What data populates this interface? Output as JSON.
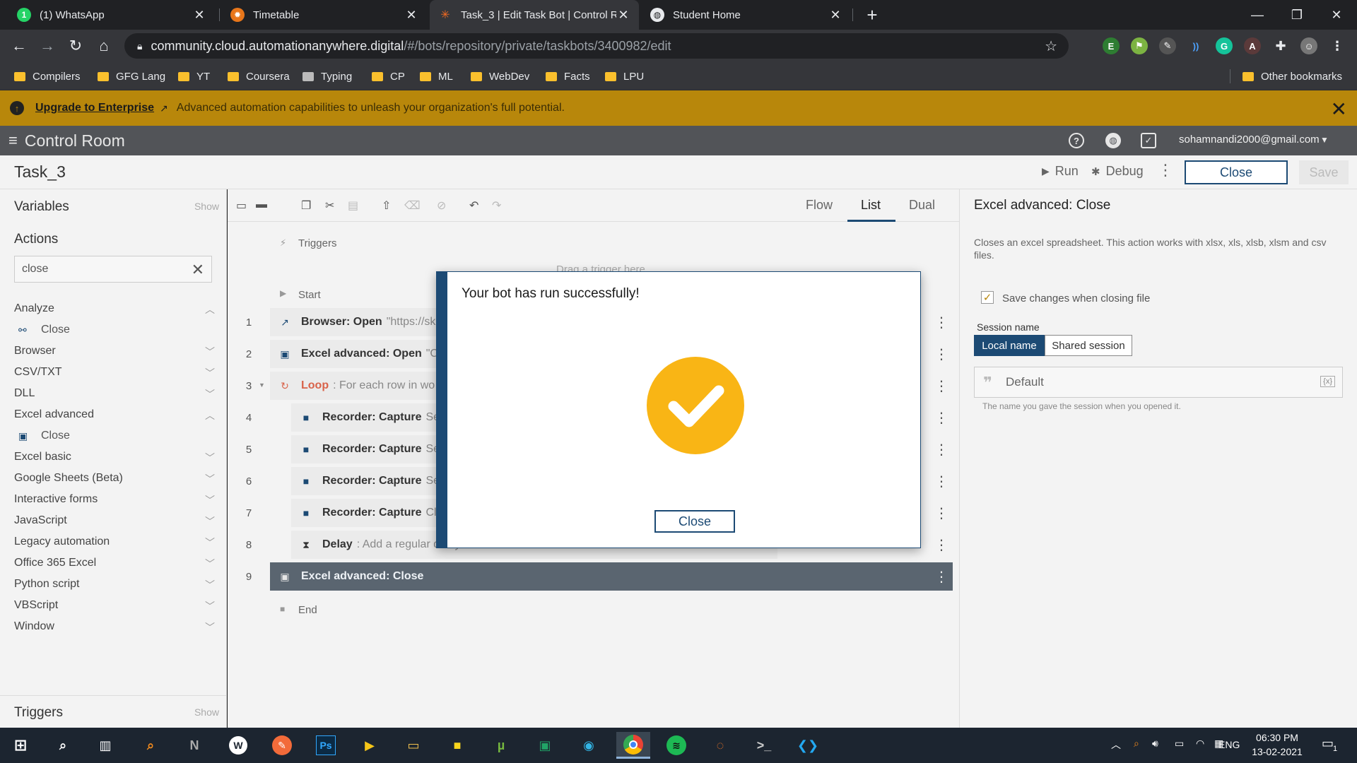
{
  "browser": {
    "tabs": [
      {
        "title": "(1) WhatsApp",
        "icon": "whatsapp-icon",
        "active": false
      },
      {
        "title": "Timetable",
        "icon": "timetable-icon",
        "active": false
      },
      {
        "title": "Task_3 | Edit Task Bot | Control Ro",
        "icon": "automation-anywhere-icon",
        "active": true
      },
      {
        "title": "Student Home",
        "icon": "globe-icon",
        "active": false
      }
    ],
    "new_tab": "+",
    "url_host": "community.cloud.automationanywhere.digital",
    "url_path": "/#/bots/repository/private/taskbots/3400982/edit",
    "bookmarks": [
      "Compilers",
      "GFG Lang",
      "YT",
      "Coursera",
      "Typing",
      "CP",
      "ML",
      "WebDev",
      "Facts",
      "LPU"
    ],
    "other_bookmarks": "Other bookmarks"
  },
  "app": {
    "upgrade": {
      "link": "Upgrade to Enterprise",
      "text": "Advanced automation capabilities to unleash your organization's full potential."
    },
    "brand": "Control Room",
    "user": "sohamnandi2000@gmail.com",
    "task_title": "Task_3",
    "run": "Run",
    "debug": "Debug",
    "close": "Close",
    "save": "Save"
  },
  "left": {
    "variables": "Variables",
    "show": "Show",
    "actions": "Actions",
    "search_value": "close",
    "categories": [
      {
        "label": "Analyze",
        "expanded": true,
        "child": "Close"
      },
      {
        "label": "Browser"
      },
      {
        "label": "CSV/TXT"
      },
      {
        "label": "DLL"
      },
      {
        "label": "Excel advanced",
        "expanded": true,
        "child": "Close"
      },
      {
        "label": "Excel basic"
      },
      {
        "label": "Google Sheets (Beta)"
      },
      {
        "label": "Interactive forms"
      },
      {
        "label": "JavaScript"
      },
      {
        "label": "Legacy automation"
      },
      {
        "label": "Office 365 Excel"
      },
      {
        "label": "Python script"
      },
      {
        "label": "VBScript"
      },
      {
        "label": "Window"
      }
    ],
    "triggers": "Triggers",
    "triggers_show": "Show"
  },
  "editor": {
    "views": [
      "Flow",
      "List",
      "Dual"
    ],
    "active_view": "List",
    "triggers_label": "Triggers",
    "drag_hint": "Drag a trigger here",
    "start": "Start",
    "end": "End",
    "rows": [
      {
        "num": "1",
        "name": "Browser: Open",
        "desc": "\"https://sk",
        "icon": "browser-open-icon"
      },
      {
        "num": "2",
        "name": "Excel advanced: Open",
        "desc": "\"C:\\",
        "icon": "excel-icon"
      },
      {
        "num": "3",
        "name": "Loop",
        "desc": ": For each row in wo",
        "icon": "loop-icon"
      },
      {
        "num": "4",
        "name": "Recorder: Capture",
        "desc": "Set",
        "icon": "recorder-icon"
      },
      {
        "num": "5",
        "name": "Recorder: Capture",
        "desc": "Set",
        "icon": "recorder-icon"
      },
      {
        "num": "6",
        "name": "Recorder: Capture",
        "desc": "Set",
        "icon": "recorder-icon"
      },
      {
        "num": "7",
        "name": "Recorder: Capture",
        "desc": "Cli",
        "icon": "recorder-icon"
      },
      {
        "num": "8",
        "name": "Delay",
        "desc": ": Add a regular delay of 5 seconds",
        "icon": "hourglass-icon"
      },
      {
        "num": "9",
        "name": "Excel advanced: Close",
        "desc": "",
        "icon": "excel-icon"
      }
    ]
  },
  "right": {
    "title": "Excel advanced: Close",
    "description": "Closes an excel spreadsheet. This action works with xlsx, xls, xlsb, xlsm and csv files.",
    "save_changes": "Save changes when closing file",
    "save_changes_checked": true,
    "session_name": "Session name",
    "local_name": "Local name",
    "shared_session": "Shared session",
    "session_value": "Default",
    "session_hint": "The name you gave the session when you opened it."
  },
  "dialog": {
    "message": "Your bot has run successfully!",
    "close": "Close"
  },
  "taskbar": {
    "lang": "ENG",
    "time": "06:30 PM",
    "date": "13-02-2021",
    "notifications": "1"
  },
  "colors": {
    "accent": "#1c4a74",
    "banner": "#b8870b",
    "success": "#f9b515",
    "selected_row": "#5a6570"
  }
}
